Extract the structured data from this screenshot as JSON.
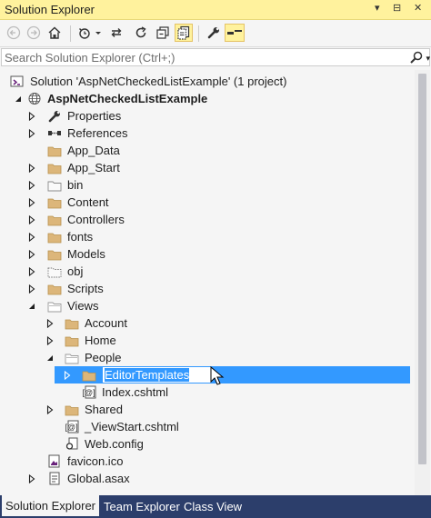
{
  "window": {
    "title": "Solution Explorer",
    "controls": [
      "▾",
      "⊟",
      "✕"
    ]
  },
  "toolbar": {
    "buttons": [
      {
        "name": "back",
        "icon": "back-arrow-icon"
      },
      {
        "name": "forward",
        "icon": "forward-arrow-icon"
      },
      {
        "name": "home",
        "icon": "home-icon"
      },
      {
        "name": "pending-changes-filter",
        "icon": "history-icon"
      },
      {
        "name": "sync-with-active-document",
        "icon": "sync-icon"
      },
      {
        "name": "refresh",
        "icon": "refresh-icon"
      },
      {
        "name": "collapse-all",
        "icon": "collapse-all-icon"
      },
      {
        "name": "show-all-files",
        "icon": "show-all-files-icon"
      },
      {
        "name": "properties",
        "icon": "wrench-icon"
      },
      {
        "name": "preview-selected-items",
        "icon": "preview-icon"
      }
    ]
  },
  "search": {
    "placeholder": "Search Solution Explorer (Ctrl+;)",
    "value": ""
  },
  "tree": {
    "solution": "Solution 'AspNetCheckedListExample' (1 project)",
    "project": "AspNetCheckedListExample",
    "items": [
      {
        "label": "Properties",
        "icon": "wrench-icon",
        "level": 2,
        "expander": "collapsed"
      },
      {
        "label": "References",
        "icon": "references-icon",
        "level": 2,
        "expander": "collapsed"
      },
      {
        "label": "App_Data",
        "icon": "folder-icon",
        "level": 2,
        "expander": "none"
      },
      {
        "label": "App_Start",
        "icon": "folder-icon",
        "level": 2,
        "expander": "collapsed"
      },
      {
        "label": "bin",
        "icon": "folder-outline-icon",
        "level": 2,
        "expander": "collapsed"
      },
      {
        "label": "Content",
        "icon": "folder-icon",
        "level": 2,
        "expander": "collapsed"
      },
      {
        "label": "Controllers",
        "icon": "folder-icon",
        "level": 2,
        "expander": "collapsed"
      },
      {
        "label": "fonts",
        "icon": "folder-icon",
        "level": 2,
        "expander": "collapsed"
      },
      {
        "label": "Models",
        "icon": "folder-icon",
        "level": 2,
        "expander": "collapsed"
      },
      {
        "label": "obj",
        "icon": "folder-dashed-icon",
        "level": 2,
        "expander": "collapsed"
      },
      {
        "label": "Scripts",
        "icon": "folder-icon",
        "level": 2,
        "expander": "collapsed"
      },
      {
        "label": "Views",
        "icon": "folder-open-icon",
        "level": 2,
        "expander": "expanded"
      },
      {
        "label": "Account",
        "icon": "folder-icon",
        "level": 3,
        "expander": "collapsed"
      },
      {
        "label": "Home",
        "icon": "folder-icon",
        "level": 3,
        "expander": "collapsed"
      },
      {
        "label": "People",
        "icon": "folder-open-icon",
        "level": 3,
        "expander": "expanded"
      },
      {
        "label": "EditorTemplates",
        "icon": "folder-icon",
        "level": 4,
        "expander": "collapsed",
        "selected": true,
        "editing": true
      },
      {
        "label": "Index.cshtml",
        "icon": "razor-file-icon",
        "level": 4,
        "expander": "none"
      },
      {
        "label": "Shared",
        "icon": "folder-icon",
        "level": 3,
        "expander": "collapsed"
      },
      {
        "label": "_ViewStart.cshtml",
        "icon": "razor-file-icon",
        "level": 3,
        "expander": "none"
      },
      {
        "label": "Web.config",
        "icon": "config-file-icon",
        "level": 3,
        "expander": "none"
      },
      {
        "label": "favicon.ico",
        "icon": "image-file-icon",
        "level": 2,
        "expander": "none"
      },
      {
        "label": "Global.asax",
        "icon": "global-asax-icon",
        "level": 2,
        "expander": "collapsed"
      }
    ]
  },
  "bottom_tabs": [
    {
      "label": "Solution Explorer",
      "active": true
    },
    {
      "label": "Team Explorer",
      "active": false
    },
    {
      "label": "Class View",
      "active": false
    }
  ],
  "colors": {
    "title_bar": "#fff29d",
    "selection": "#3399ff",
    "tab_strip": "#2c3e6b",
    "folder": "#dcb67a"
  }
}
